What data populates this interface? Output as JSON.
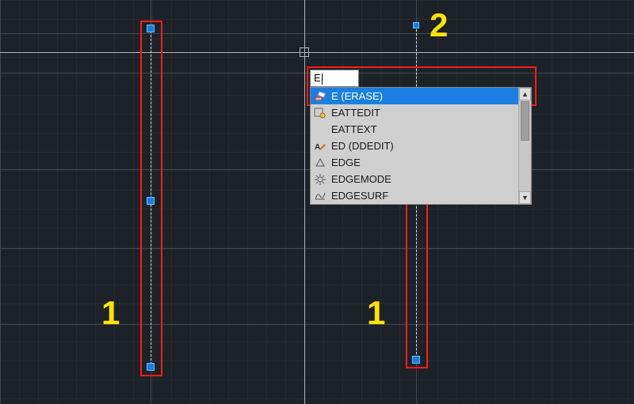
{
  "annotations": {
    "left_label": "1",
    "right_label": "1",
    "top_label": "2"
  },
  "command": {
    "input_value": "E",
    "suggestions": [
      {
        "label": "E (ERASE)",
        "icon": "erase-icon",
        "selected": true
      },
      {
        "label": "EATTEDIT",
        "icon": "attedit-icon",
        "selected": false
      },
      {
        "label": "EATTEXT",
        "icon": "blank-icon",
        "selected": false
      },
      {
        "label": "ED (DDEDIT)",
        "icon": "ddedit-icon",
        "selected": false
      },
      {
        "label": "EDGE",
        "icon": "edge-icon",
        "selected": false
      },
      {
        "label": "EDGEMODE",
        "icon": "gear-icon",
        "selected": false
      },
      {
        "label": "EDGESURF",
        "icon": "edgesurf-icon",
        "selected": false
      }
    ],
    "scroll_up_glyph": "▲",
    "scroll_down_glyph": "▼"
  }
}
